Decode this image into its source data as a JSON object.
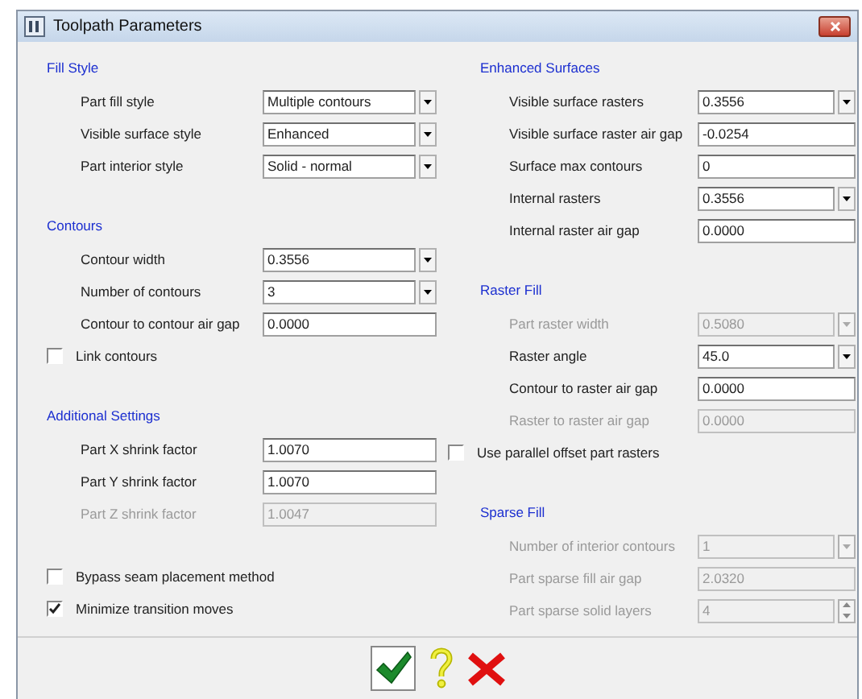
{
  "window": {
    "title": "Toolpath Parameters"
  },
  "columns": [
    {
      "sections": [
        {
          "title": "Fill Style",
          "rows": [
            {
              "kind": "dropdown",
              "label": "Part fill style",
              "value": "Multiple contours",
              "disabled": false
            },
            {
              "kind": "dropdown",
              "label": "Visible surface style",
              "value": "Enhanced",
              "disabled": false
            },
            {
              "kind": "dropdown",
              "label": "Part interior style",
              "value": "Solid - normal",
              "disabled": false
            }
          ]
        },
        {
          "title": "Contours",
          "rows": [
            {
              "kind": "dropdown",
              "label": "Contour width",
              "value": "0.3556",
              "disabled": false
            },
            {
              "kind": "dropdown",
              "label": "Number of contours",
              "value": "3",
              "disabled": false
            },
            {
              "kind": "text",
              "label": "Contour to contour air gap",
              "value": "0.0000",
              "disabled": false
            },
            {
              "kind": "checkbox",
              "label": "Link contours",
              "checked": false
            }
          ]
        },
        {
          "title": "Additional Settings",
          "rows": [
            {
              "kind": "text",
              "label": "Part X shrink factor",
              "value": "1.0070",
              "disabled": false
            },
            {
              "kind": "text",
              "label": "Part Y shrink factor",
              "value": "1.0070",
              "disabled": false
            },
            {
              "kind": "text",
              "label": "Part Z shrink factor",
              "value": "1.0047",
              "disabled": true
            }
          ]
        },
        {
          "rows": [
            {
              "kind": "checkbox",
              "label": "Bypass seam placement method",
              "checked": false
            },
            {
              "kind": "checkbox",
              "label": "Minimize transition moves",
              "checked": true
            }
          ]
        }
      ]
    },
    {
      "sections": [
        {
          "title": "Enhanced Surfaces",
          "rows": [
            {
              "kind": "dropdown",
              "label": "Visible surface rasters",
              "value": "0.3556",
              "disabled": false
            },
            {
              "kind": "text",
              "label": "Visible surface raster air gap",
              "value": "-0.0254",
              "disabled": false
            },
            {
              "kind": "text",
              "label": "Surface max contours",
              "value": "0",
              "disabled": false
            },
            {
              "kind": "dropdown",
              "label": "Internal rasters",
              "value": "0.3556",
              "disabled": false
            },
            {
              "kind": "text",
              "label": "Internal raster air gap",
              "value": "0.0000",
              "disabled": false
            }
          ]
        },
        {
          "title": "Raster Fill",
          "rows": [
            {
              "kind": "dropdown",
              "label": "Part raster width",
              "value": "0.5080",
              "disabled": true
            },
            {
              "kind": "dropdown",
              "label": "Raster angle",
              "value": "45.0",
              "disabled": false
            },
            {
              "kind": "text",
              "label": "Contour to raster air gap",
              "value": "0.0000",
              "disabled": false
            },
            {
              "kind": "text",
              "label": "Raster to raster air gap",
              "value": "0.0000",
              "disabled": true
            },
            {
              "kind": "checkbox",
              "label": "Use parallel offset part rasters",
              "checked": false
            }
          ]
        },
        {
          "title": "Sparse Fill",
          "rows": [
            {
              "kind": "dropdown",
              "label": "Number of interior contours",
              "value": "1",
              "disabled": true
            },
            {
              "kind": "text",
              "label": "Part sparse fill air gap",
              "value": "2.0320",
              "disabled": true
            },
            {
              "kind": "spin",
              "label": "Part sparse solid layers",
              "value": "4",
              "disabled": true
            }
          ]
        }
      ]
    }
  ],
  "buttons": [
    {
      "kind": "ok"
    },
    {
      "kind": "help"
    },
    {
      "kind": "cancel"
    }
  ]
}
